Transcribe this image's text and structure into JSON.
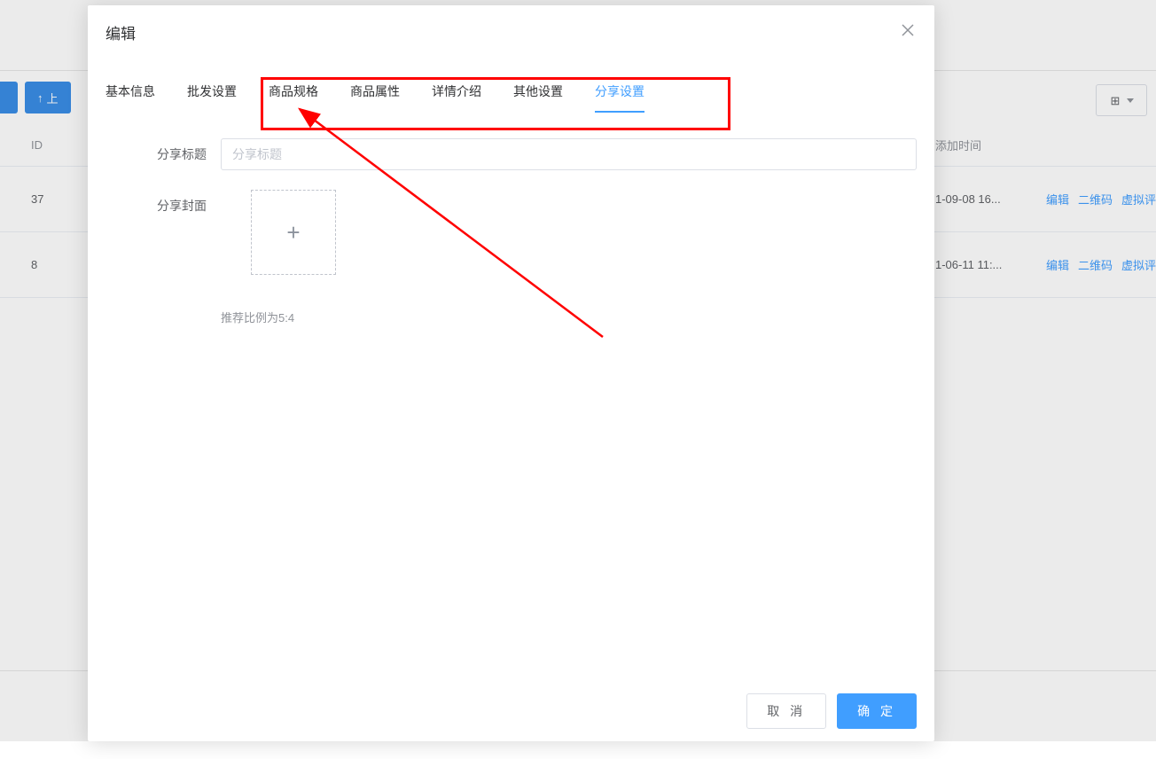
{
  "background": {
    "upload_btn_prefix": "上",
    "table": {
      "header_id": "ID",
      "header_time": "添加时间",
      "rows": [
        {
          "id": "37",
          "time": "1-09-08 16..."
        },
        {
          "id": "8",
          "time": "1-06-11 11:..."
        }
      ],
      "action_edit": "编辑",
      "action_qrcode": "二维码",
      "action_virtual": "虚拟评"
    }
  },
  "modal": {
    "title": "编辑",
    "tabs": {
      "basic": "基本信息",
      "wholesale": "批发设置",
      "spec": "商品规格",
      "attr": "商品属性",
      "detail": "详情介绍",
      "other": "其他设置",
      "share": "分享设置"
    },
    "form": {
      "share_title_label": "分享标题",
      "share_title_placeholder": "分享标题",
      "share_cover_label": "分享封面",
      "ratio_hint": "推荐比例为5:4"
    },
    "footer": {
      "cancel": "取 消",
      "confirm": "确 定"
    }
  }
}
